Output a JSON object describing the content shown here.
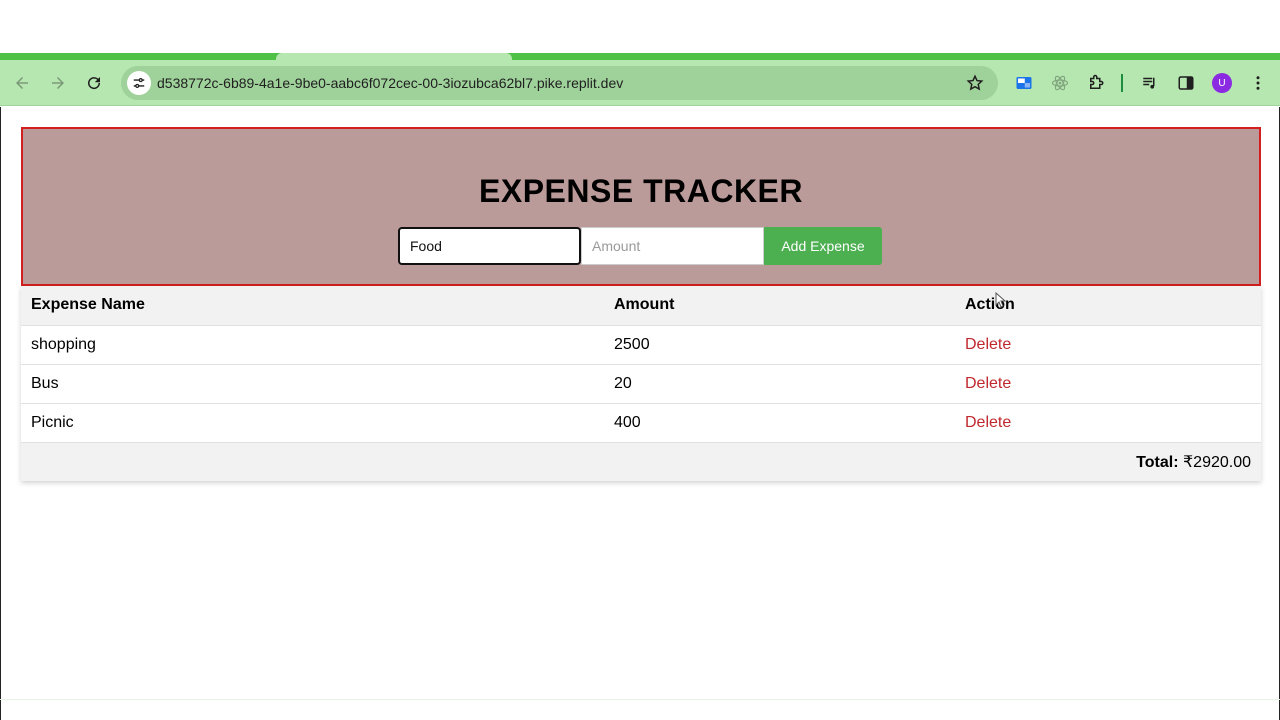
{
  "browser": {
    "url": "d538772c-6b89-4a1e-9be0-aabc6f072cec-00-3iozubca62bl7.pike.replit.dev",
    "profile_initial": "U",
    "theme_color": "#b6e7b1",
    "tab_strip_color": "#4fc146"
  },
  "app": {
    "title": "EXPENSE TRACKER",
    "header_bg": "#bb9b99",
    "header_border": "#d21e1e",
    "form": {
      "name_value": "Food",
      "amount_placeholder": "Amount",
      "add_label": "Add Expense",
      "button_color": "#4caf50"
    },
    "table": {
      "headers": [
        "Expense Name",
        "Amount",
        "Action"
      ],
      "rows": [
        {
          "name": "shopping",
          "amount": "2500",
          "action": "Delete"
        },
        {
          "name": "Bus",
          "amount": "20",
          "action": "Delete"
        },
        {
          "name": "Picnic",
          "amount": "400",
          "action": "Delete"
        }
      ],
      "total_label": "Total:",
      "total_value": "₹2920.00"
    }
  }
}
